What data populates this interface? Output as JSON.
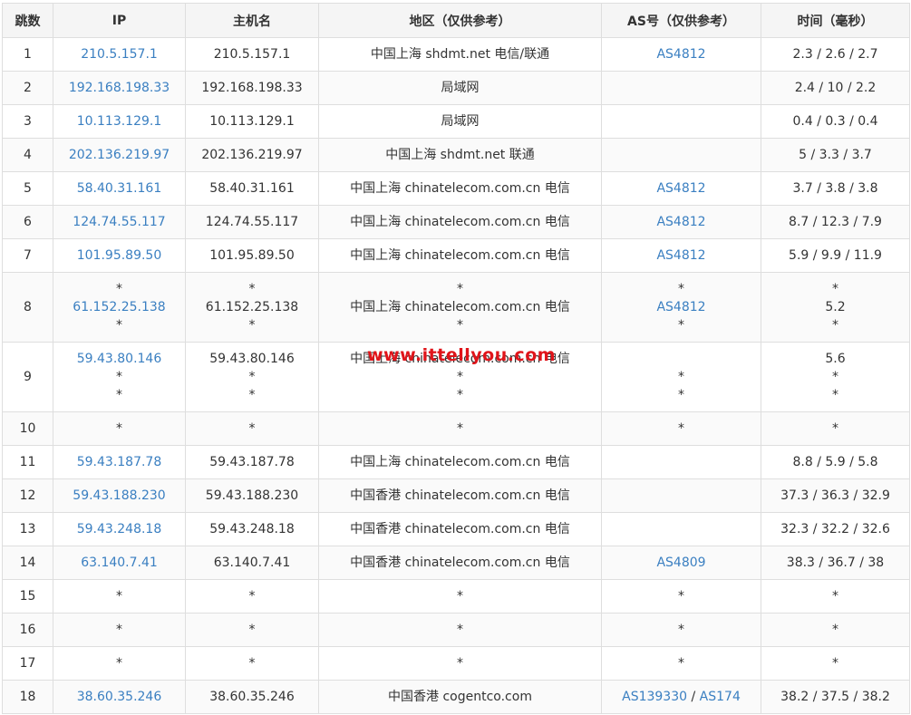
{
  "headers": {
    "hop": "跳数",
    "ip": "IP",
    "host": "主机名",
    "region": "地区（仅供参考）",
    "as": "AS号（仅供参考）",
    "time": "时间（毫秒）"
  },
  "watermark": "www.ittellyou.com",
  "rows": [
    {
      "hop": "1",
      "ip": [
        "210.5.157.1"
      ],
      "host": [
        "210.5.157.1"
      ],
      "region": [
        "中国上海 shdmt.net 电信/联通"
      ],
      "as": [
        [
          "AS4812"
        ]
      ],
      "time": [
        "2.3 / 2.6 / 2.7"
      ]
    },
    {
      "hop": "2",
      "ip": [
        "192.168.198.33"
      ],
      "host": [
        "192.168.198.33"
      ],
      "region": [
        "局域网"
      ],
      "as": [
        []
      ],
      "time": [
        "2.4 / 10 / 2.2"
      ]
    },
    {
      "hop": "3",
      "ip": [
        "10.113.129.1"
      ],
      "host": [
        "10.113.129.1"
      ],
      "region": [
        "局域网"
      ],
      "as": [
        []
      ],
      "time": [
        "0.4 / 0.3 / 0.4"
      ]
    },
    {
      "hop": "4",
      "ip": [
        "202.136.219.97"
      ],
      "host": [
        "202.136.219.97"
      ],
      "region": [
        "中国上海 shdmt.net 联通"
      ],
      "as": [
        []
      ],
      "time": [
        "5 / 3.3 / 3.7"
      ]
    },
    {
      "hop": "5",
      "ip": [
        "58.40.31.161"
      ],
      "host": [
        "58.40.31.161"
      ],
      "region": [
        "中国上海 chinatelecom.com.cn 电信"
      ],
      "as": [
        [
          "AS4812"
        ]
      ],
      "time": [
        "3.7 / 3.8 / 3.8"
      ]
    },
    {
      "hop": "6",
      "ip": [
        "124.74.55.117"
      ],
      "host": [
        "124.74.55.117"
      ],
      "region": [
        "中国上海 chinatelecom.com.cn 电信"
      ],
      "as": [
        [
          "AS4812"
        ]
      ],
      "time": [
        "8.7 / 12.3 / 7.9"
      ]
    },
    {
      "hop": "7",
      "ip": [
        "101.95.89.50"
      ],
      "host": [
        "101.95.89.50"
      ],
      "region": [
        "中国上海 chinatelecom.com.cn 电信"
      ],
      "as": [
        [
          "AS4812"
        ]
      ],
      "time": [
        "5.9 / 9.9 / 11.9"
      ]
    },
    {
      "hop": "8",
      "ip": [
        "*",
        "61.152.25.138",
        "*"
      ],
      "host": [
        "*",
        "61.152.25.138",
        "*"
      ],
      "region": [
        "*",
        "中国上海 chinatelecom.com.cn 电信",
        "*"
      ],
      "as": [
        [
          "*"
        ],
        [
          "AS4812"
        ],
        [
          "*"
        ]
      ],
      "time": [
        "*",
        "5.2",
        "*"
      ]
    },
    {
      "hop": "9",
      "ip": [
        "59.43.80.146",
        "*",
        "*"
      ],
      "host": [
        "59.43.80.146",
        "*",
        "*"
      ],
      "region": [
        "中国上海 chinatelecom.com.cn 电信",
        "*",
        "*"
      ],
      "as": [
        [],
        [
          "*"
        ],
        [
          "*"
        ]
      ],
      "time": [
        "5.6",
        "*",
        "*"
      ]
    },
    {
      "hop": "10",
      "ip": [
        "*"
      ],
      "host": [
        "*"
      ],
      "region": [
        "*"
      ],
      "as": [
        [
          "*"
        ]
      ],
      "time": [
        "*"
      ]
    },
    {
      "hop": "11",
      "ip": [
        "59.43.187.78"
      ],
      "host": [
        "59.43.187.78"
      ],
      "region": [
        "中国上海 chinatelecom.com.cn 电信"
      ],
      "as": [
        []
      ],
      "time": [
        "8.8 / 5.9 / 5.8"
      ]
    },
    {
      "hop": "12",
      "ip": [
        "59.43.188.230"
      ],
      "host": [
        "59.43.188.230"
      ],
      "region": [
        "中国香港 chinatelecom.com.cn 电信"
      ],
      "as": [
        []
      ],
      "time": [
        "37.3 / 36.3 / 32.9"
      ]
    },
    {
      "hop": "13",
      "ip": [
        "59.43.248.18"
      ],
      "host": [
        "59.43.248.18"
      ],
      "region": [
        "中国香港 chinatelecom.com.cn 电信"
      ],
      "as": [
        []
      ],
      "time": [
        "32.3 / 32.2 / 32.6"
      ]
    },
    {
      "hop": "14",
      "ip": [
        "63.140.7.41"
      ],
      "host": [
        "63.140.7.41"
      ],
      "region": [
        "中国香港 chinatelecom.com.cn 电信"
      ],
      "as": [
        [
          "AS4809"
        ]
      ],
      "time": [
        "38.3 / 36.7 / 38"
      ]
    },
    {
      "hop": "15",
      "ip": [
        "*"
      ],
      "host": [
        "*"
      ],
      "region": [
        "*"
      ],
      "as": [
        [
          "*"
        ]
      ],
      "time": [
        "*"
      ]
    },
    {
      "hop": "16",
      "ip": [
        "*"
      ],
      "host": [
        "*"
      ],
      "region": [
        "*"
      ],
      "as": [
        [
          "*"
        ]
      ],
      "time": [
        "*"
      ]
    },
    {
      "hop": "17",
      "ip": [
        "*"
      ],
      "host": [
        "*"
      ],
      "region": [
        "*"
      ],
      "as": [
        [
          "*"
        ]
      ],
      "time": [
        "*"
      ]
    },
    {
      "hop": "18",
      "ip": [
        "38.60.35.246"
      ],
      "host": [
        "38.60.35.246"
      ],
      "region": [
        "中国香港 cogentco.com"
      ],
      "as": [
        [
          "AS139330",
          "AS174"
        ]
      ],
      "time": [
        "38.2 / 37.5 / 38.2"
      ]
    }
  ],
  "colors": {
    "link": "#3a7fc1",
    "border": "#dedede",
    "header_bg": "#f5f5f5",
    "watermark": "#e0141a"
  }
}
